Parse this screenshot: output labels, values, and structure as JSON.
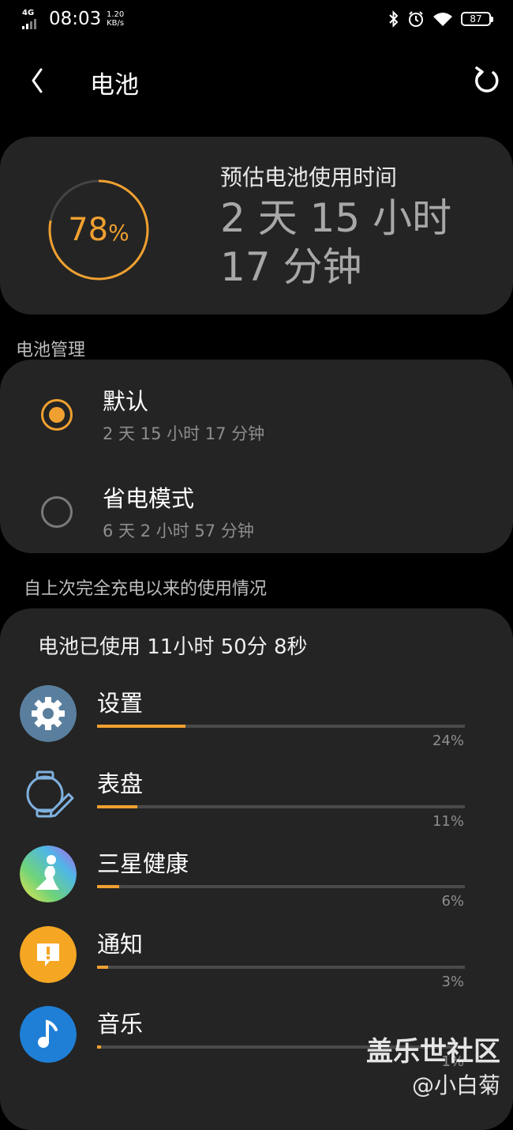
{
  "status_bar": {
    "network": "4G",
    "time": "08:03",
    "speed_value": "1.20",
    "speed_unit": "KB/s",
    "icons": [
      "bluetooth-icon",
      "alarm-icon",
      "wifi-icon"
    ],
    "battery": "87"
  },
  "app_bar": {
    "back_icon": "chevron-left-icon",
    "title": "电池",
    "reset_icon": "refresh-icon"
  },
  "estimate": {
    "percent": "78",
    "percent_sign": "%",
    "level_fraction": 0.78,
    "label": "预估电池使用时间",
    "value": "2 天 15 小时 17 分钟"
  },
  "management": {
    "header": "电池管理",
    "options": [
      {
        "name": "默认",
        "time": "2 天 15 小时 17 分钟",
        "selected": true
      },
      {
        "name": "省电模式",
        "time": "6 天 2 小时 57 分钟",
        "selected": false
      }
    ]
  },
  "usage": {
    "header": "自上次完全充电以来的使用情况",
    "total": "电池已使用 11小时 50分 8秒",
    "apps": [
      {
        "name": "设置",
        "percent": "24%",
        "value": 0.24,
        "icon": "gear-icon"
      },
      {
        "name": "表盘",
        "percent": "11%",
        "value": 0.11,
        "icon": "watchface-edit-icon"
      },
      {
        "name": "三星健康",
        "percent": "6%",
        "value": 0.06,
        "icon": "health-icon"
      },
      {
        "name": "通知",
        "percent": "3%",
        "value": 0.03,
        "icon": "notification-icon"
      },
      {
        "name": "音乐",
        "percent": "1%",
        "value": 0.01,
        "icon": "music-note-icon"
      }
    ]
  },
  "watermark": {
    "line1": "盖乐世社区",
    "line2": "@小白菊"
  },
  "colors": {
    "accent": "#f0a030",
    "card": "#242424",
    "background": "#000000"
  }
}
